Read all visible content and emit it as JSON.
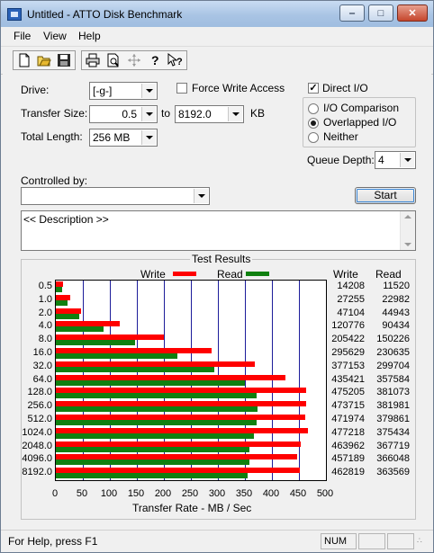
{
  "window": {
    "title": "Untitled - ATTO Disk Benchmark"
  },
  "menu": [
    "File",
    "View",
    "Help"
  ],
  "toolbar": {
    "icons": [
      "new-icon",
      "open-icon",
      "save-icon",
      "print-icon",
      "print-preview-icon",
      "move-icon",
      "help-icon",
      "context-help-icon"
    ]
  },
  "drive": {
    "label": "Drive:",
    "value": "[-g-]"
  },
  "force_write": {
    "label": "Force Write Access",
    "checked": false
  },
  "direct_io": {
    "label": "Direct I/O",
    "checked": true
  },
  "transfer": {
    "label": "Transfer Size:",
    "from": "0.5",
    "to_label": "to",
    "to": "8192.0",
    "unit": "KB"
  },
  "total_length": {
    "label": "Total Length:",
    "value": "256 MB"
  },
  "io_mode": {
    "options": [
      "I/O Comparison",
      "Overlapped I/O",
      "Neither"
    ],
    "selected": "Overlapped I/O"
  },
  "queue_depth": {
    "label": "Queue Depth:",
    "value": "4"
  },
  "controlled_by": {
    "label": "Controlled by:",
    "value": ""
  },
  "start_button": "Start",
  "description": "<< Description >>",
  "results": {
    "title": "Test Results",
    "legend_write": "Write",
    "legend_read": "Read",
    "col_write": "Write",
    "col_read": "Read",
    "xlabel": "Transfer Rate - MB / Sec",
    "rows": [
      {
        "size": "0.5",
        "write": "14208",
        "read": "11520"
      },
      {
        "size": "1.0",
        "write": "27255",
        "read": "22982"
      },
      {
        "size": "2.0",
        "write": "47104",
        "read": "44943"
      },
      {
        "size": "4.0",
        "write": "120776",
        "read": "90434"
      },
      {
        "size": "8.0",
        "write": "205422",
        "read": "150226"
      },
      {
        "size": "16.0",
        "write": "295629",
        "read": "230635"
      },
      {
        "size": "32.0",
        "write": "377153",
        "read": "299704"
      },
      {
        "size": "64.0",
        "write": "435421",
        "read": "357584"
      },
      {
        "size": "128.0",
        "write": "475205",
        "read": "381073"
      },
      {
        "size": "256.0",
        "write": "473715",
        "read": "381981"
      },
      {
        "size": "512.0",
        "write": "471974",
        "read": "379861"
      },
      {
        "size": "1024.0",
        "write": "477218",
        "read": "375434"
      },
      {
        "size": "2048.0",
        "write": "463962",
        "read": "367719"
      },
      {
        "size": "4096.0",
        "write": "457189",
        "read": "366048"
      },
      {
        "size": "8192.0",
        "write": "462819",
        "read": "363569"
      }
    ]
  },
  "chart_data": {
    "type": "bar",
    "categories": [
      "0.5",
      "1.0",
      "2.0",
      "4.0",
      "8.0",
      "16.0",
      "32.0",
      "64.0",
      "128.0",
      "256.0",
      "512.0",
      "1024.0",
      "2048.0",
      "4096.0",
      "8192.0"
    ],
    "series": [
      {
        "name": "Write",
        "color": "#ff0000",
        "values": [
          13.9,
          26.6,
          46.0,
          117.9,
          200.6,
          288.7,
          368.3,
          425.2,
          464.1,
          462.6,
          460.9,
          466.0,
          453.1,
          446.5,
          452.0
        ]
      },
      {
        "name": "Read",
        "color": "#108010",
        "values": [
          11.3,
          22.4,
          43.9,
          88.3,
          146.7,
          225.2,
          292.7,
          349.2,
          372.1,
          373.0,
          371.0,
          366.6,
          359.1,
          357.5,
          355.0
        ]
      }
    ],
    "xlabel": "Transfer Rate - MB / Sec",
    "xlim": [
      0,
      500
    ],
    "ticks": [
      "0",
      "50",
      "100",
      "150",
      "200",
      "250",
      "300",
      "350",
      "400",
      "450",
      "500"
    ],
    "orientation": "horizontal",
    "grid": true,
    "legend": "top"
  },
  "status": {
    "text": "For Help, press F1",
    "num": "NUM"
  }
}
